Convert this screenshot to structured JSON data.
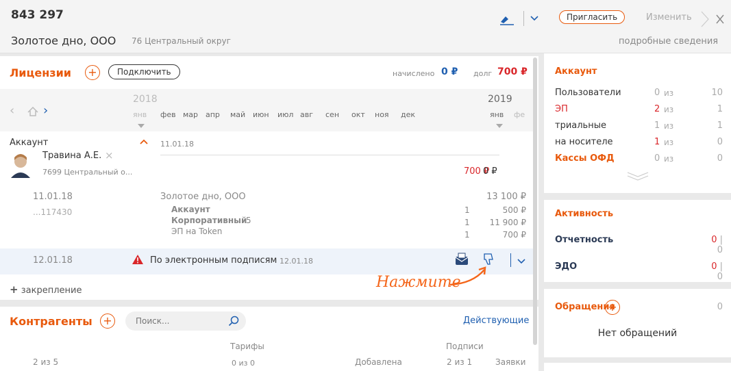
{
  "header": {
    "id": "843 297",
    "company": "Золотое дно, ООО",
    "region": "76 Центральный округ",
    "invite_label": "Пригласить",
    "edit_label": "Изменить",
    "details_label": "подробные сведения"
  },
  "licenses": {
    "title": "Лицензии",
    "connect_label": "Подключить",
    "accrued_label": "начислено",
    "accrued_value": "0 ₽",
    "debt_label": "долг",
    "debt_value": "700 ₽",
    "year_start": "2018",
    "year_end": "2019",
    "months": [
      "янв",
      "фев",
      "мар",
      "апр",
      "май",
      "июн",
      "июл",
      "авг",
      "сен",
      "окт",
      "ноя",
      "дек",
      "янв",
      "фе"
    ],
    "account_label": "Аккаунт",
    "account_date": "11.01.18",
    "user_name": "Травина А.Е.",
    "user_org": "7699 Центральный о...",
    "sum_red": "700 ₽",
    "sum_black": "0 ₽",
    "order": {
      "date": "11.01.18",
      "number": "...117430",
      "company": "Золотое дно, ООО",
      "total": "13 100 ₽",
      "items": [
        {
          "name": "Аккаунт",
          "extra": "",
          "qty": "1",
          "price": "500 ₽"
        },
        {
          "name": "Корпоративный",
          "extra": "5",
          "qty": "1",
          "price": "11 900 ₽"
        },
        {
          "name": "ЭП на Token",
          "extra": "",
          "qty": "1",
          "price": "700 ₽"
        }
      ]
    },
    "warning": {
      "date": "12.01.18",
      "text": "По электронным подписям",
      "text_date": "12.01.18"
    },
    "press_label": "Нажмите",
    "attach_label": "закрепление"
  },
  "contractors": {
    "title": "Контрагенты",
    "search_placeholder": "Поиск...",
    "filter_label": "Действующие",
    "col_tariffs": "Тарифы",
    "col_signatures": "Подписи",
    "row": {
      "count": "2 из 5",
      "tariffs": "0 из 0",
      "added": "Добавлена",
      "signatures": "2 из 1",
      "requests": "Заявки"
    }
  },
  "account": {
    "title": "Аккаунт",
    "rows": [
      {
        "label": "Пользователи",
        "used": "0",
        "of": "из",
        "total": "10"
      },
      {
        "label": "ЭП",
        "used": "2",
        "of": "из",
        "total": "1"
      },
      {
        "label": "триальные",
        "used": "1",
        "of": "из",
        "total": "1"
      },
      {
        "label": "на носителе",
        "used": "1",
        "of": "из",
        "total": "0"
      },
      {
        "label": "Кассы ОФД",
        "used": "0",
        "of": "из",
        "total": "0"
      }
    ]
  },
  "activity": {
    "title": "Активность",
    "reporting_label": "Отчетность",
    "reporting_value": "0",
    "reporting_value2": "0",
    "edo_label": "ЭДО",
    "edo_value": "0",
    "edo_value2": "0"
  },
  "requests": {
    "title": "Обращения",
    "count": "0",
    "empty": "Нет обращений"
  },
  "colors": {
    "accent": "#e8590c",
    "danger": "#d9262a",
    "link": "#1f5fb0"
  }
}
